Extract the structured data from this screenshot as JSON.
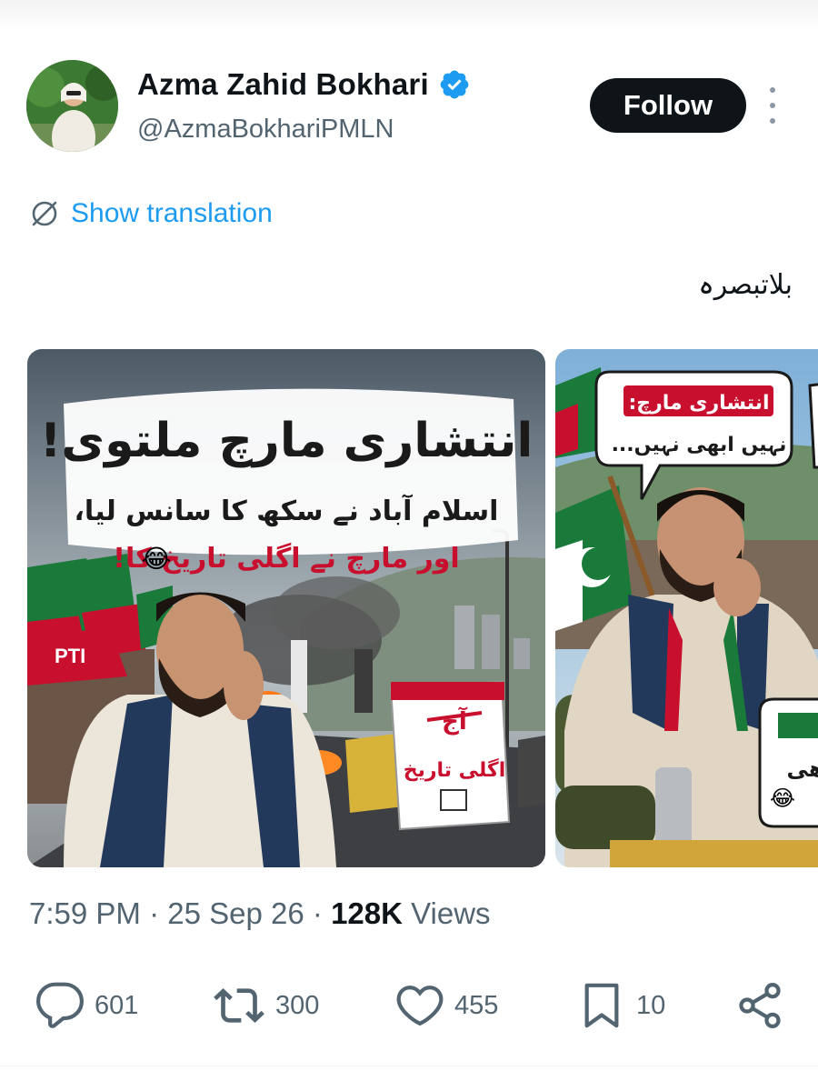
{
  "author": {
    "name": "Azma Zahid Bokhari",
    "handle": "@AzmaBokhariPMLN",
    "verified": true
  },
  "header": {
    "follow_label": "Follow",
    "more_icon": "more-vertical-icon"
  },
  "translation": {
    "label": "Show translation",
    "icon": "globe-slash-icon"
  },
  "tweet": {
    "text": "بلاتبصرہ"
  },
  "media": [
    {
      "headline": "انتشاری مارچ ملتوی!",
      "subline1": "اسلام آباد نے سکھ کا سانس لیا،",
      "subline2": "اور مارچ نے اگلی تاریخ کا!",
      "subline_emoji": "😂",
      "flag_text": "PTI",
      "calendar_top": "آج",
      "calendar_bottom": "اگلی تاریخ"
    },
    {
      "bubble_line1": "انتشاری مارچ:",
      "bubble_line2": "نہیں ابھی نہیں...",
      "side_text": "ھی",
      "side_emoji": "😂"
    }
  ],
  "meta": {
    "time": "7:59 PM",
    "date": "25 Sep 26",
    "views_count": "128K",
    "views_label": "Views",
    "separator": "·"
  },
  "actions": {
    "replies": "601",
    "reposts": "300",
    "likes": "455",
    "bookmarks": "10"
  },
  "colors": {
    "accent": "#1d9bf0",
    "text": "#0f1419",
    "secondary": "#536471",
    "follow_bg": "#0f1419",
    "headline_red": "#c8102e",
    "pti_green": "#1a7a3a"
  }
}
